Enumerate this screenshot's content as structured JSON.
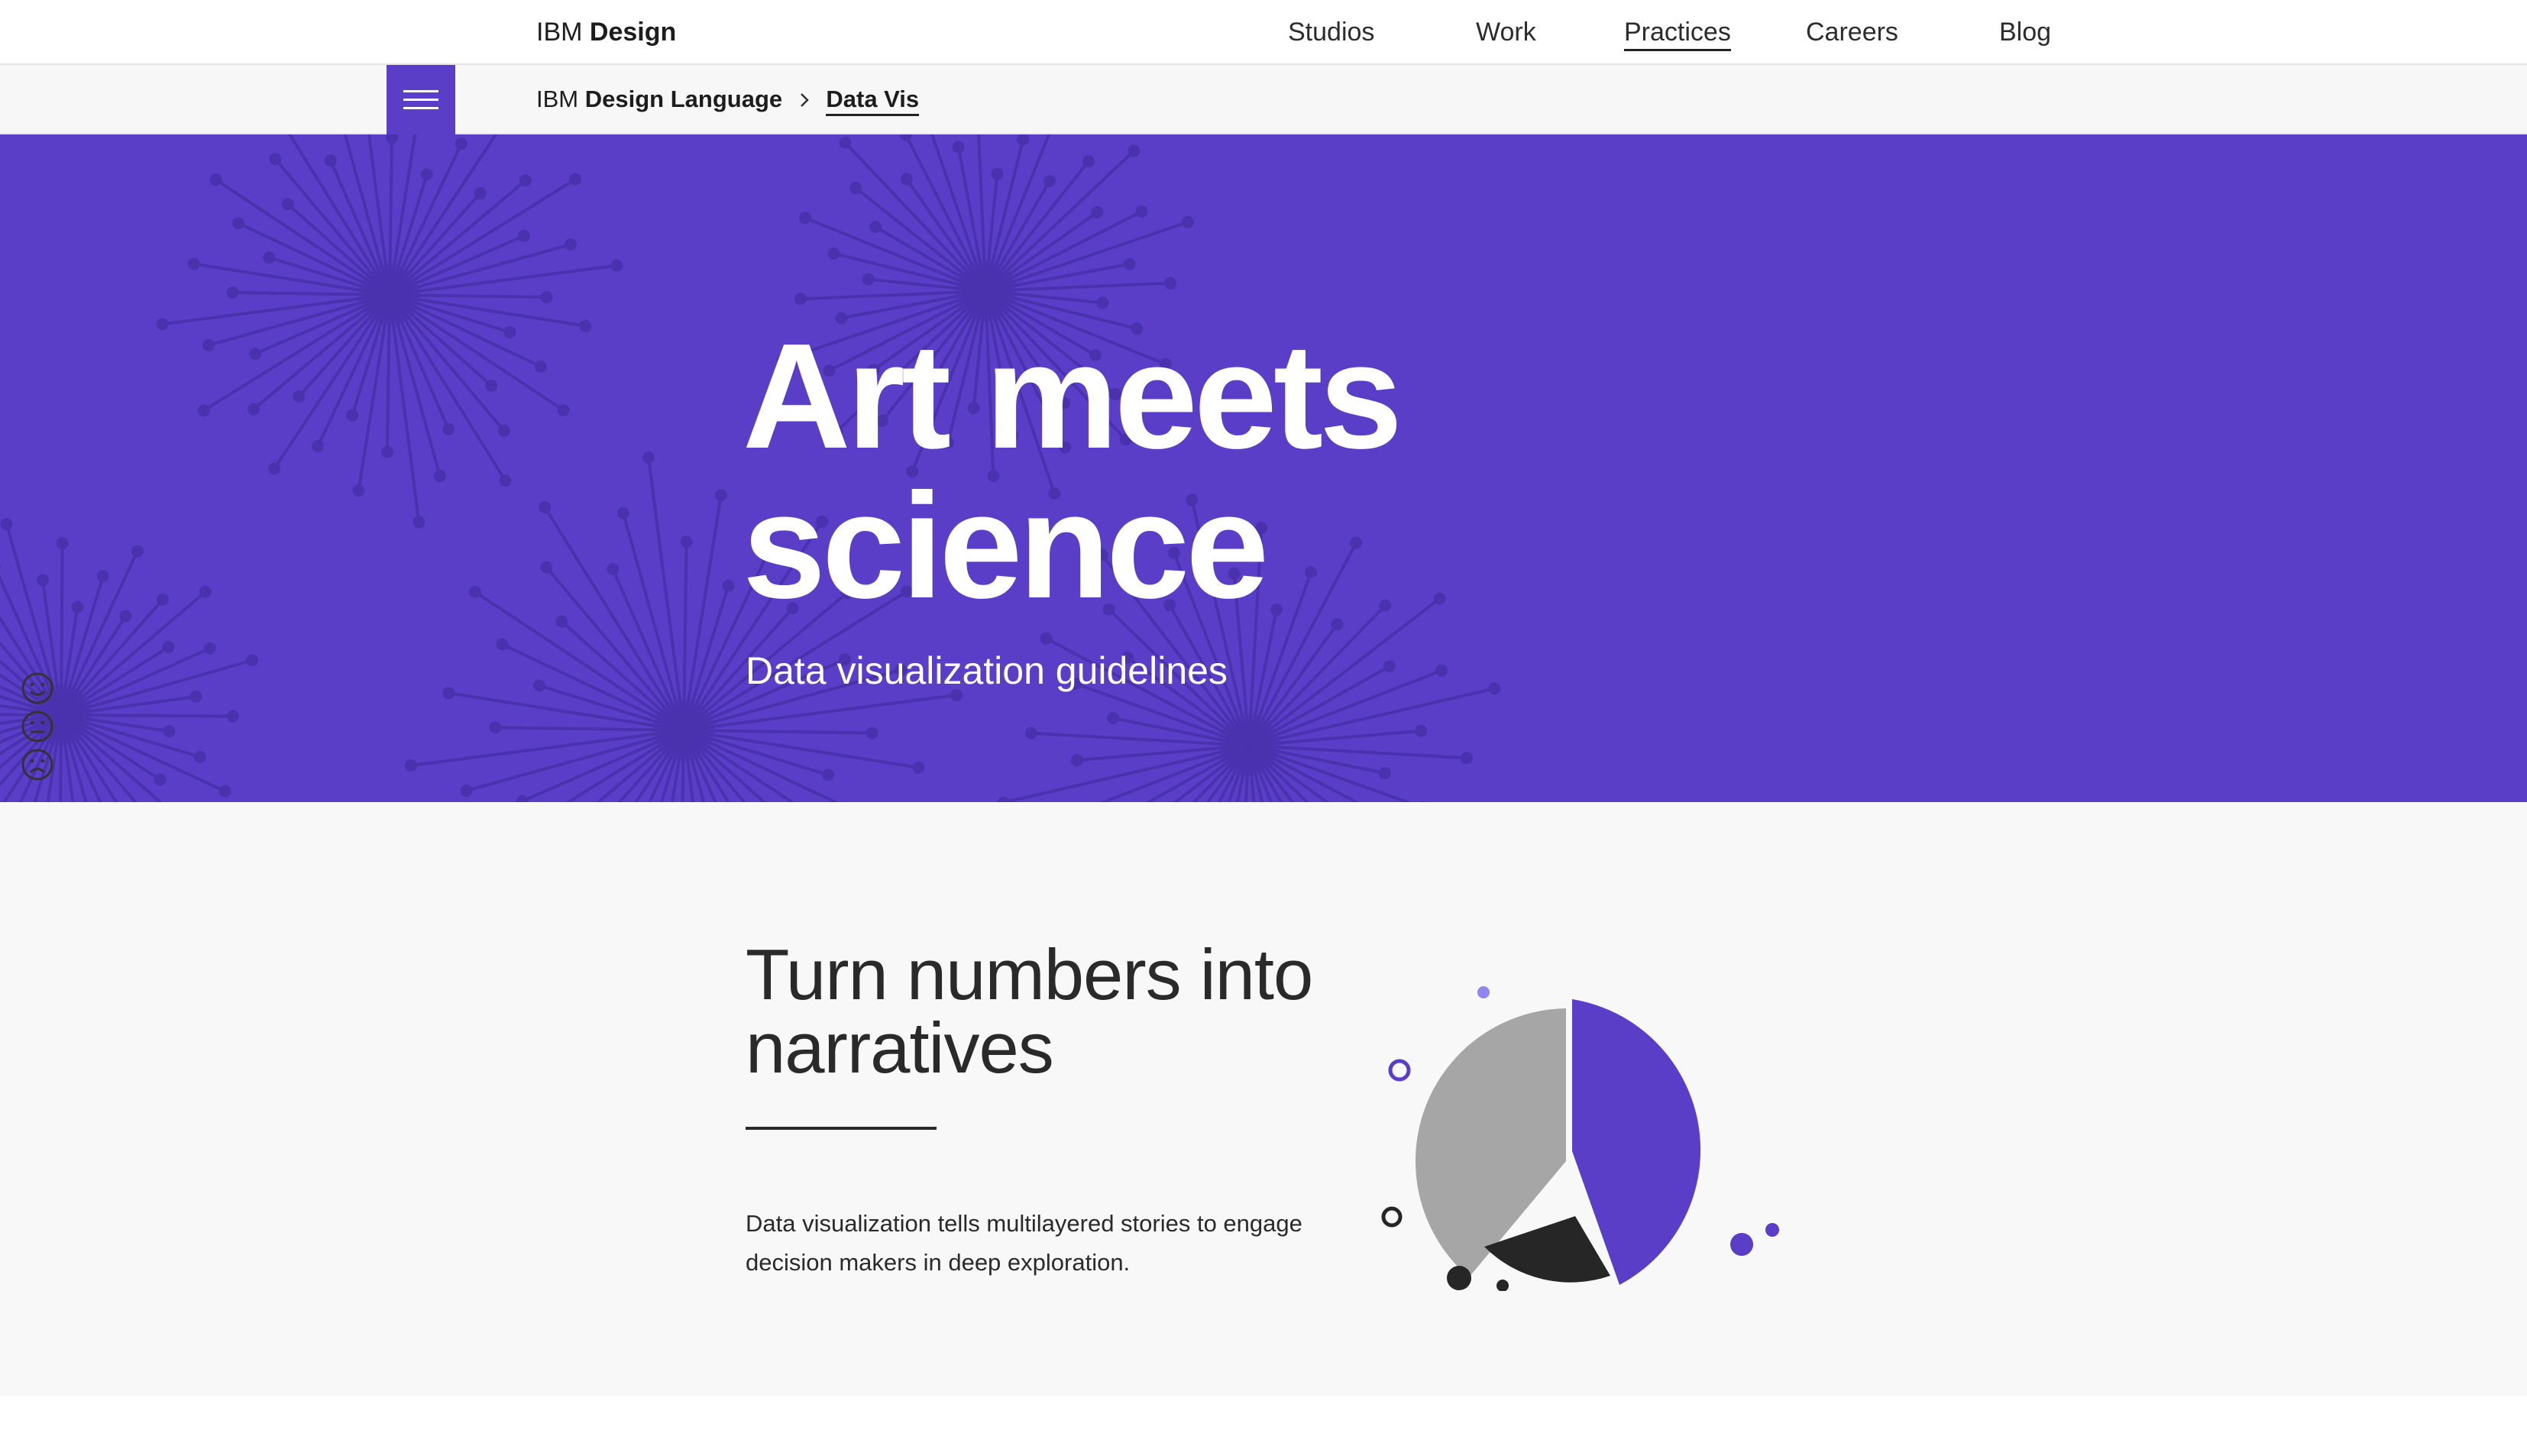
{
  "brand": {
    "prefix": "IBM",
    "name": "Design"
  },
  "nav": {
    "items": [
      {
        "label": "Studios",
        "active": false
      },
      {
        "label": "Work",
        "active": false
      },
      {
        "label": "Practices",
        "active": true
      },
      {
        "label": "Careers",
        "active": false
      },
      {
        "label": "Blog",
        "active": false
      }
    ]
  },
  "menu_button": {
    "icon": "hamburger-menu-icon"
  },
  "breadcrumb": {
    "parent_prefix": "IBM",
    "parent_name": "Design Language",
    "separator_icon": "chevron-right-icon",
    "current": "Data Vis"
  },
  "hero": {
    "title_line1": "Art meets",
    "title_line2": "science",
    "subtitle": "Data visualization guidelines",
    "background_color": "#5a3ec8",
    "pattern_color": "#4a31ad",
    "pattern": "starburst-pattern"
  },
  "feedback": {
    "icons": [
      "smiley-happy-icon",
      "smiley-neutral-icon",
      "smiley-sad-icon"
    ]
  },
  "intro": {
    "title_line1": "Turn numbers into",
    "title_line2": "narratives",
    "body": "Data visualization tells multilayered stories to engage decision makers in deep exploration."
  },
  "colors": {
    "accent": "#5a3ec8",
    "text": "#222222",
    "pie_gray": "#a6a6a6",
    "pie_dark": "#262626",
    "light_accent": "#8f86ee"
  }
}
